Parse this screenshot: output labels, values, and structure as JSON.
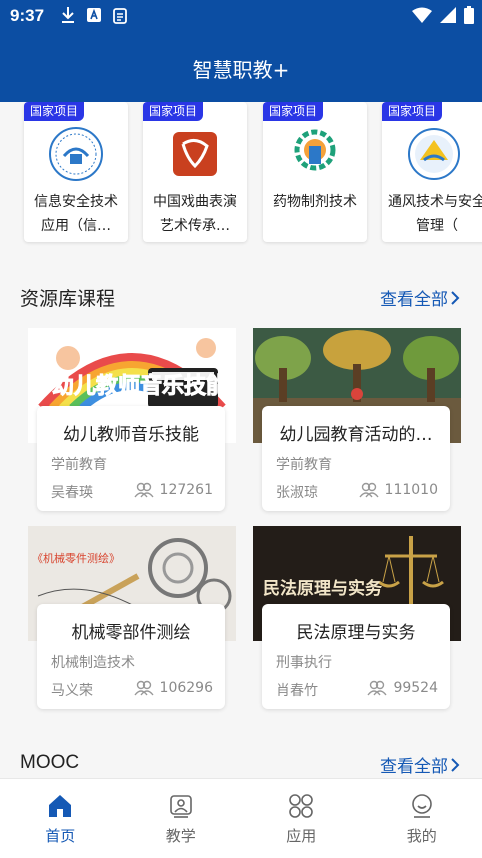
{
  "status_bar": {
    "time": "9:37"
  },
  "header": {
    "title": "智慧职教+"
  },
  "projects": {
    "items": [
      {
        "tag": "国家项目",
        "name": "信息安全技术应用（信…"
      },
      {
        "tag": "国家项目",
        "name": "中国戏曲表演艺术传承…"
      },
      {
        "tag": "国家项目",
        "name": "药物制剂技术"
      },
      {
        "tag": "国家项目",
        "name": "通风技术与安全管理（"
      }
    ]
  },
  "resource_section": {
    "title": "资源库课程",
    "view_all": "查看全部"
  },
  "courses": [
    {
      "thumb_text": "幼儿教师音乐技能",
      "title": "幼儿教师音乐技能",
      "category": "学前教育",
      "teacher": "吴春瑛",
      "count": "127261"
    },
    {
      "thumb_text": "",
      "title": "幼儿园教育活动的…",
      "category": "学前教育",
      "teacher": "张淑琼",
      "count": "111010"
    },
    {
      "thumb_text": "《机械零件测绘》",
      "title": "机械零部件测绘",
      "category": "机械制造技术",
      "teacher": "马义荣",
      "count": "106296"
    },
    {
      "thumb_text": "民法原理与实务",
      "title": "民法原理与实务",
      "category": "刑事执行",
      "teacher": "肖春竹",
      "count": "99524"
    }
  ],
  "mooc_section": {
    "title": "MOOC",
    "view_all": "查看全部"
  },
  "bottom_nav": {
    "items": [
      {
        "label": "首页",
        "icon": "home-icon",
        "active": true
      },
      {
        "label": "教学",
        "icon": "teaching-icon",
        "active": false
      },
      {
        "label": "应用",
        "icon": "apps-icon",
        "active": false
      },
      {
        "label": "我的",
        "icon": "profile-icon",
        "active": false
      }
    ]
  },
  "colors": {
    "brand": "#0c4ea3",
    "accent": "#1559b5",
    "tag": "#2a36e6"
  }
}
